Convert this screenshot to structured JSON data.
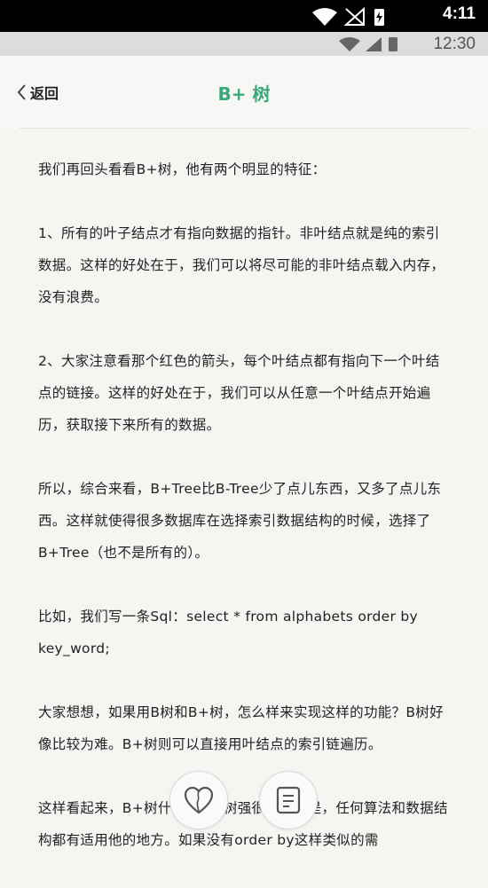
{
  "status_bar_outer": {
    "time": "4:11"
  },
  "status_bar_inner": {
    "time": "12:30"
  },
  "header": {
    "back_label": "返回",
    "title": "B+ 树"
  },
  "article": {
    "paragraphs": [
      "我们再回头看看B+树，他有两个明显的特征：",
      "1、所有的叶子结点才有指向数据的指针。非叶结点就是纯的索引数据。这样的好处在于，我们可以将尽可能的非叶结点载入内存，没有浪费。",
      "2、大家注意看那个红色的箭头，每个叶结点都有指向下一个叶结点的链接。这样的好处在于，我们可以从任意一个叶结点开始遍历，获取接下来所有的数据。",
      "所以，综合来看，B+Tree比B-Tree少了点儿东西，又多了点儿东西。这样就使得很多数据库在选择索引数据结构的时候，选择了B+Tree（也不是所有的）。",
      "比如，我们写一条Sql：select * from alphabets order by key_word;",
      "大家想想，如果用B树和B+树，怎么样来实现这样的功能？B树好像比较为难。B+树则可以直接用叶结点的索引链遍历。",
      "这样看起来，B+树什么都比B树强很多吗？是，任何算法和数据结构都有适用他的地方。如果没有order by这样类似的需"
    ]
  },
  "colors": {
    "accent": "#3aa878"
  }
}
